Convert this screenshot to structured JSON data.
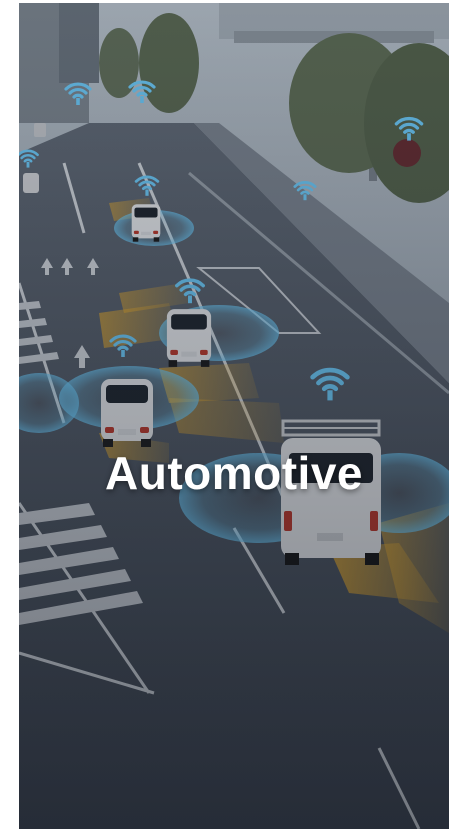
{
  "hero": {
    "title": "Automotive"
  },
  "colors": {
    "signal": "#5ec4ff",
    "sensor": "#f0b42a",
    "road": "#4a5260"
  },
  "icons": [
    "wifi-signal-icon"
  ]
}
